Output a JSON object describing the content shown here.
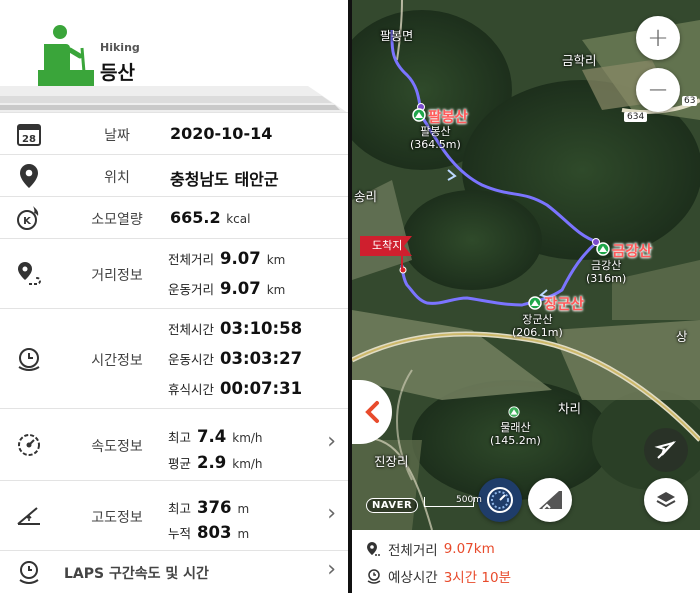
{
  "header": {
    "category": "Hiking",
    "title": "등산"
  },
  "rows": {
    "date": {
      "label": "날짜",
      "value": "2020-10-14",
      "icon": "calendar-icon",
      "day": "28"
    },
    "location": {
      "label": "위치",
      "value": "충청남도 태안군",
      "icon": "location-pin-icon"
    },
    "calories": {
      "label": "소모열량",
      "value": "665.2",
      "unit": "kcal",
      "icon": "calorie-flame-icon"
    },
    "distance": {
      "label": "거리정보",
      "icon": "route-pin-icon",
      "total_k": "전체거리",
      "total_v": "9.07",
      "total_u": "km",
      "move_k": "운동거리",
      "move_v": "9.07",
      "move_u": "km"
    },
    "time": {
      "label": "시간정보",
      "icon": "clock-icon",
      "total_k": "전체시간",
      "total_v": "03:10:58",
      "move_k": "운동시간",
      "move_v": "03:03:27",
      "rest_k": "휴식시간",
      "rest_v": "00:07:31"
    },
    "speed": {
      "label": "속도정보",
      "icon": "speedometer-icon",
      "max_k": "최고",
      "max_v": "7.4",
      "max_u": "km/h",
      "avg_k": "평균",
      "avg_v": "2.9",
      "avg_u": "km/h"
    },
    "altitude": {
      "label": "고도정보",
      "icon": "elevation-icon",
      "max_k": "최고",
      "max_v": "376",
      "max_u": "m",
      "cum_k": "누적",
      "cum_v": "803",
      "cum_u": "m"
    },
    "laps": {
      "label": "LAPS 구간속도 및 시간",
      "icon": "laps-clock-icon"
    }
  },
  "map": {
    "labels": {
      "top": "팔봉면",
      "geumhak": "금학리",
      "songri": "송리",
      "chari": "차리",
      "jinjang": "진장리",
      "palbong_small": "팔봉산",
      "palbong_h": "(364.5m)",
      "geumgang_small": "금강산",
      "geumgang_h": "(316m)",
      "janggun_small": "장군산",
      "janggun_h": "(206.1m)",
      "mullae": "물래산",
      "mullae_h": "(145.2m)",
      "road": "634",
      "road2": "63",
      "brand": "NAVER",
      "scale": "500m",
      "side": "상"
    },
    "peaks": {
      "palbong": "팔봉산",
      "geumgang": "금강산",
      "janggun": "장군산"
    },
    "finish_flag": "도착지",
    "zoom_in": "+",
    "zoom_out": "−",
    "route_color": "#7b74ff",
    "accent_color": "#e84b2c"
  },
  "info": {
    "distance_k": "전체거리",
    "distance_v": "9.07km",
    "eta_k": "예상시간",
    "eta_v": "3시간 10분"
  }
}
